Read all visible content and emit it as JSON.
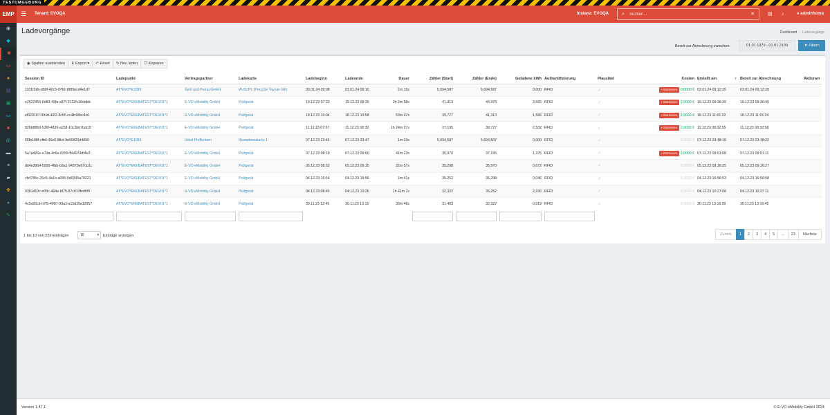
{
  "banner": {
    "label": "TESTUMGEBUNG"
  },
  "topbar": {
    "logo": "EMP",
    "tenant": "Tenant: EVOQA",
    "instance": "Instanz: EVOQA",
    "search_placeholder": "Suchen...",
    "user": "adminhoma"
  },
  "sidebar": {
    "items": [
      {
        "icon": "dashboard-icon",
        "glyph": "◉",
        "color": "#b8c7ce"
      },
      {
        "icon": "cat-icon",
        "glyph": "◆",
        "color": "#00c0ef"
      },
      {
        "icon": "plug-icon",
        "glyph": "✱",
        "color": "#dd4b39"
      },
      {
        "icon": "card-icon",
        "glyph": "▭",
        "color": "#dd4b39"
      },
      {
        "icon": "money-icon",
        "glyph": "●",
        "color": "#f39c12"
      },
      {
        "icon": "document-icon",
        "glyph": "▤",
        "color": "#605ca8"
      },
      {
        "icon": "plug-two-icon",
        "glyph": "▣",
        "color": "#00a65a"
      },
      {
        "icon": "card-two-icon",
        "glyph": "▭",
        "color": "#00c0ef"
      },
      {
        "icon": "cart-icon",
        "glyph": "■",
        "color": "#dd4b39"
      },
      {
        "icon": "eye-icon",
        "glyph": "◎",
        "color": "#39cccc"
      },
      {
        "icon": "car-icon",
        "glyph": "▬",
        "color": "#b8c7ce"
      },
      {
        "icon": "list-icon",
        "glyph": "≡",
        "color": "#b8c7ce"
      },
      {
        "icon": "truck-icon",
        "glyph": "▰",
        "color": "#b8c7ce"
      },
      {
        "icon": "paw-icon",
        "glyph": "✤",
        "color": "#f39c12"
      },
      {
        "icon": "user-icon",
        "glyph": "●",
        "color": "#3c8dbc"
      },
      {
        "icon": "wrench-icon",
        "glyph": "✎",
        "color": "#00a65a"
      }
    ]
  },
  "page": {
    "title": "Ladevorgänge",
    "breadcrumb_home": "Dashboard",
    "breadcrumb_current": "Ladevorgänge",
    "bereit_label": "Bereit zur Abrechnung zwischen",
    "date_range": "01.01.1970 - 01.01.2100",
    "filter_button": "Filtern"
  },
  "toolbar": {
    "columns": "Spalten ausblenden",
    "export": "Export",
    "reset": "Reset",
    "reload": "Neu laden",
    "copy": "Kopieren"
  },
  "table": {
    "columns": [
      "Session ID",
      "Ladepunkt",
      "Vertragspartner",
      "Ladekarte",
      "Ladebeginn",
      "Ladeende",
      "Dauer",
      "Zähler (Start)",
      "Zähler (Ende)",
      "Geladene kWh",
      "Authentifizierung",
      "Plausibel",
      "Kosten",
      "Erstellt am",
      "Bereit zur Abrechnung",
      "Aktionen"
    ],
    "storno_label": "Stornieren",
    "rows": [
      {
        "session": "1101f2db-d69f-40c5-9761-8f89ecd4e1d7",
        "ladepunkt": "AT*EVO*E1099",
        "partner": "Sprit und Pump GmbH",
        "karte": "W-SUP1 (Porsche Taycan GF)",
        "beginn": "03.01.24 09:08",
        "ende": "03.01.24 09:10",
        "dauer": "1m 19s",
        "zstart": "5.694,587",
        "zende": "5.694,587",
        "kwh": "0,000",
        "auth": "RFID",
        "kosten": "0,0000 €",
        "storno": true,
        "erstellt": "03.01.24 09:12:26",
        "bereit": "03.01.24 09:12:28"
      },
      {
        "session": "e2622456-6d83-49fa-a87f-3132fc18ddbb",
        "ladepunkt": "AT*EVO*EKEBATEST*DEV01*1",
        "partner": "E-VO eMobility GmbH",
        "karte": "Prüfgerät",
        "beginn": "19.12.23 07:33",
        "ende": "19.12.23 09:36",
        "dauer": "2h 2m 58s",
        "zstart": "41,313",
        "zende": "44,978",
        "kwh": "3,665",
        "auth": "RFID",
        "kosten": "2,0000 €",
        "storno": true,
        "erstellt": "19.12.23 09:36:39",
        "bereit": "19.12.23 09:36:46"
      },
      {
        "session": "ef020107-994d-40f2-8c65-cc4fc96bc4c6",
        "ladepunkt": "AT*EVO*EKEBATEST*DEV01*1",
        "partner": "E-VO eMobility GmbH",
        "karte": "Prüfgerät",
        "beginn": "18.12.23 10:04",
        "ende": "18.12.23 10:58",
        "dauer": "53m 47s",
        "zstart": "39,727",
        "zende": "41,313",
        "kwh": "1,586",
        "auth": "RFID",
        "kosten": "2,0000 €",
        "storno": true,
        "erstellt": "18.12.23 11:01:22",
        "bereit": "18.12.23 11:01:24"
      },
      {
        "session": "826b8869-536f-4839-a258-10c3bb7bdc3f",
        "ladepunkt": "AT*EVO*EKEBATEST*DEV01*1",
        "partner": "E-VO eMobility GmbH",
        "karte": "Prüfgerät",
        "beginn": "11.12.23 07:07",
        "ende": "11.12.23 08:32",
        "dauer": "1h 24m 27s",
        "zstart": "37,195",
        "zende": "39,727",
        "kwh": "2,532",
        "auth": "RFID",
        "kosten": "2,0000 €",
        "storno": true,
        "erstellt": "11.12.23 08:32:55",
        "bereit": "11.12.23 08:32:58"
      },
      {
        "session": "f33b188f-cfb9-46e8-88cf-9e55829d4890",
        "ladepunkt": "AT*EVO*E1099",
        "partner": "Hotel Pfefferkorn",
        "karte": "Rezeptionskarte 1",
        "beginn": "07.12.23 23:46",
        "ende": "07.12.23 23:47",
        "dauer": "1m 33s",
        "zstart": "5.694,587",
        "zende": "5.694,587",
        "kwh": "0,000",
        "auth": "RFID",
        "kosten": "0,0000 €",
        "storno": false,
        "erstellt": "07.12.23 23:48:19",
        "bereit": "07.12.23 23:48:22"
      },
      {
        "session": "5a7ad26e-e7da-4c6e-8359-ff44974df4e3",
        "ladepunkt": "AT*EVO*EKEBATEST*DEV01*1",
        "partner": "E-VO eMobility GmbH",
        "karte": "Prüfgerät",
        "beginn": "07.12.23 08:19",
        "ende": "07.12.23 09:00",
        "dauer": "41m 23s",
        "zstart": "35,970",
        "zende": "37,195",
        "kwh": "1,225",
        "auth": "RFID",
        "kosten": "2,0000 €",
        "storno": true,
        "erstellt": "07.12.23 09:01:08",
        "bereit": "07.12.23 09:01:11"
      },
      {
        "session": "dd4e3664-5926-4fbb-b9a1-94370e67cb1c",
        "ladepunkt": "AT*EVO*EKEBATEST*DEV01*1",
        "partner": "E-VO eMobility GmbH",
        "karte": "Prüfgerät",
        "beginn": "05.12.23 08:52",
        "ende": "05.12.23 09:15",
        "dauer": "22m 57s",
        "zstart": "35,298",
        "zende": "35,970",
        "kwh": "0,672",
        "auth": "RFID",
        "kosten": "0,0000 €",
        "storno": false,
        "erstellt": "05.12.23 09:16:25",
        "bereit": "05.12.23 09:16:27"
      },
      {
        "session": "cfef785c-26c5-4a1b-a095-5d0345a79221",
        "ladepunkt": "AT*EVO*EKEBATEST*DEV01*1",
        "partner": "E-VO eMobility GmbH",
        "karte": "Prüfgerät",
        "beginn": "04.12.23 16:54",
        "ende": "04.12.23 16:56",
        "dauer": "1m 41s",
        "zstart": "35,252",
        "zende": "35,298",
        "kwh": "0,046",
        "auth": "RFID",
        "kosten": "0,0000 €",
        "storno": false,
        "erstellt": "04.12.23 16:56:53",
        "bereit": "04.12.23 16:56:58"
      },
      {
        "session": "0301d10c-e09c-464e-bf75-87c013fed6f9",
        "ladepunkt": "AT*EVO*EKEBATEST*DEV01*1",
        "partner": "E-VO eMobility GmbH",
        "karte": "Prüfgerät",
        "beginn": "04.12.23 08:45",
        "ende": "04.12.23 10:26",
        "dauer": "1h 41m 7s",
        "zstart": "32,322",
        "zende": "35,252",
        "kwh": "2,930",
        "auth": "RFID",
        "kosten": "0,0000 €",
        "storno": false,
        "erstellt": "04.12.23 10:27:08",
        "bereit": "04.12.23 10:27:11"
      },
      {
        "session": "4c5a93cb-b7f5-4907-99a3-a15d39a12957",
        "ladepunkt": "AT*EVO*EKEBATEST*DEV01*1",
        "partner": "E-VO eMobility GmbH",
        "karte": "Prüfgerät",
        "beginn": "30.11.23 12:45",
        "ende": "30.11.23 13:15",
        "dauer": "30m 48s",
        "zstart": "31,403",
        "zende": "32,322",
        "kwh": "0,919",
        "auth": "RFID",
        "kosten": "0,0000 €",
        "storno": false,
        "erstellt": "30.11.23 13:16:39",
        "bereit": "30.11.23 13:16:42"
      }
    ]
  },
  "table_footer": {
    "info": "1 bis 10 von 222 Einträgen",
    "length": "10",
    "length_label": "Einträge anzeigen",
    "pages": [
      "Zurück",
      "1",
      "2",
      "3",
      "4",
      "5",
      "…",
      "23",
      "Nächste"
    ]
  },
  "footer": {
    "version": "Version 1.47.1",
    "copyright": "© E-VO eMobility GmbH 2024"
  }
}
